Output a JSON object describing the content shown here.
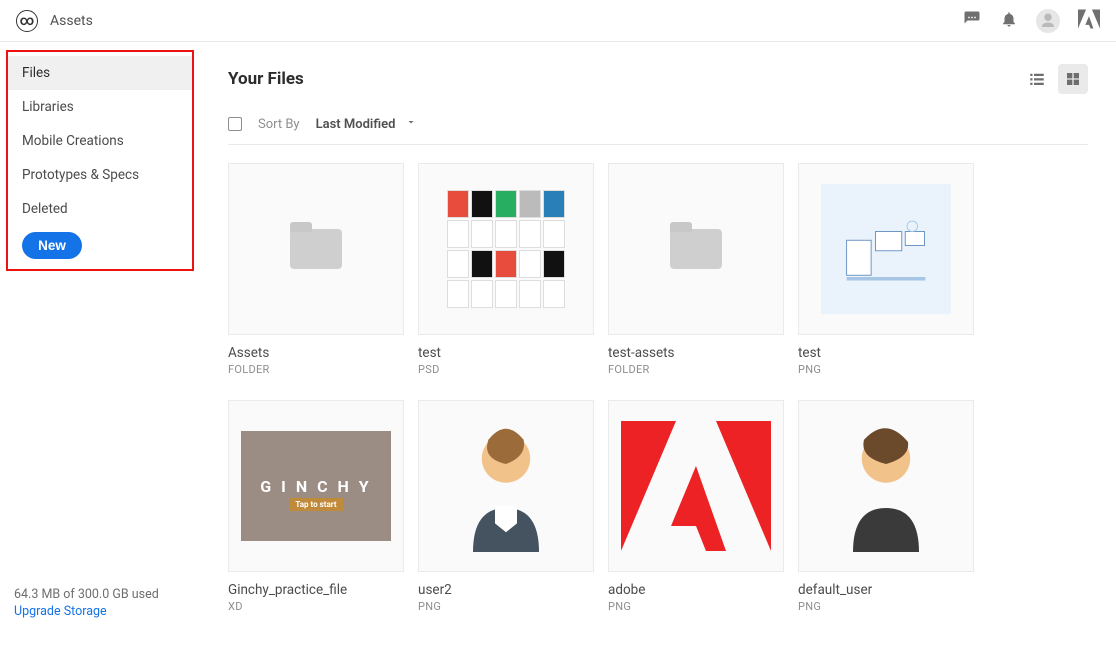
{
  "header": {
    "title": "Assets"
  },
  "sidebar": {
    "items": [
      {
        "label": "Files",
        "active": true
      },
      {
        "label": "Libraries"
      },
      {
        "label": "Mobile Creations"
      },
      {
        "label": "Prototypes & Specs"
      },
      {
        "label": "Deleted"
      }
    ],
    "new_label": "New",
    "storage_text": "64.3 MB of 300.0 GB used",
    "upgrade_label": "Upgrade Storage"
  },
  "main": {
    "title": "Your Files",
    "sort_label": "Sort By",
    "sort_value": "Last Modified",
    "files": [
      {
        "name": "Assets",
        "type": "FOLDER"
      },
      {
        "name": "test",
        "type": "PSD"
      },
      {
        "name": "test-assets",
        "type": "FOLDER"
      },
      {
        "name": "test",
        "type": "PNG"
      },
      {
        "name": "Ginchy_practice_file",
        "type": "XD"
      },
      {
        "name": "user2",
        "type": "PNG"
      },
      {
        "name": "adobe",
        "type": "PNG"
      },
      {
        "name": "default_user",
        "type": "PNG"
      }
    ]
  }
}
